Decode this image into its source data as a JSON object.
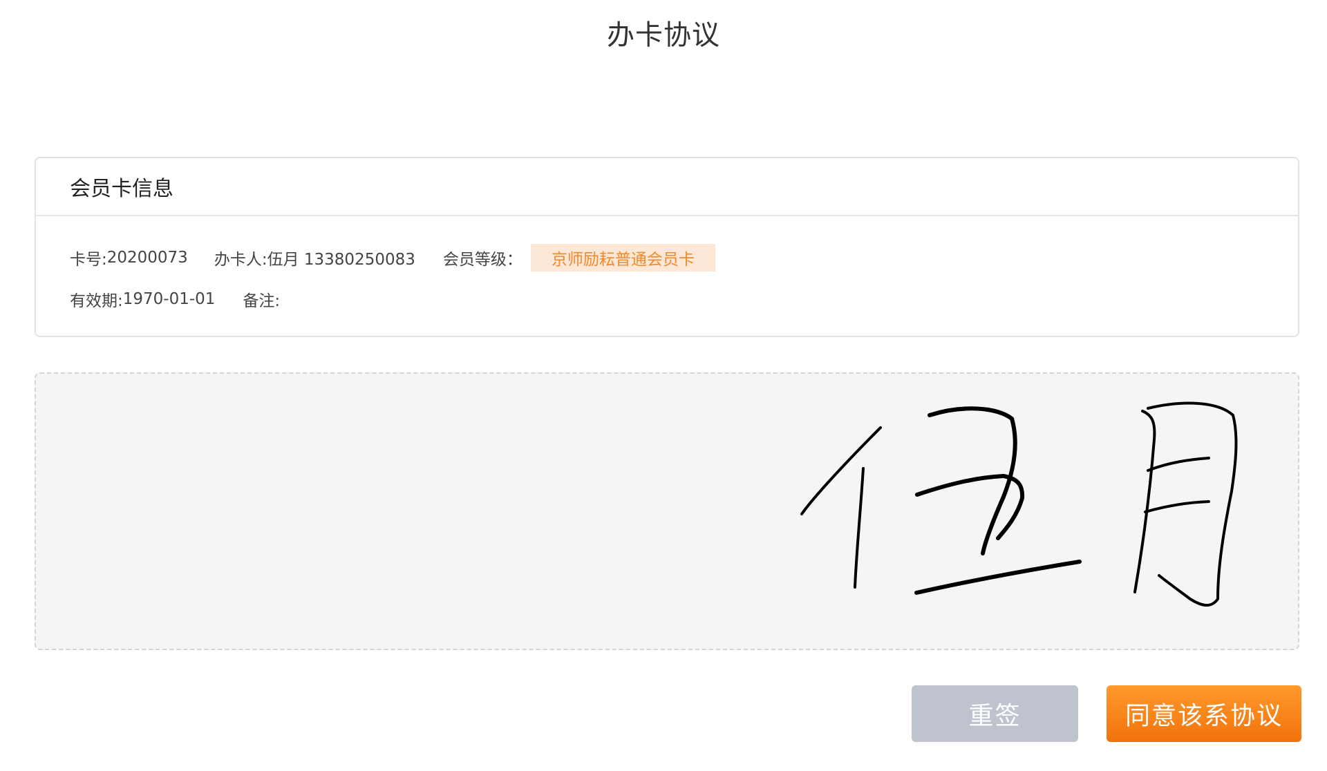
{
  "page": {
    "title": "办卡协议"
  },
  "card_info": {
    "header": "会员卡信息",
    "card_no_label": "卡号:",
    "card_no": "20200073",
    "applicant_label": "办卡人:",
    "applicant": "伍月 13380250083",
    "level_label": "会员等级：",
    "level": "京师励耘普通会员卡",
    "valid_label": "有效期:",
    "valid_date": "1970-01-01",
    "remark_label": "备注:",
    "remark": ""
  },
  "signature": {
    "drawn_text": "伍月",
    "stroke_color": "#000000"
  },
  "actions": {
    "resign_label": "重签",
    "agree_label": "同意该系协议"
  },
  "colors": {
    "accent": "#f5800f",
    "badge_bg": "#fde7d6",
    "badge_text": "#f08a2c",
    "resign_bg": "#bfc3ce"
  }
}
